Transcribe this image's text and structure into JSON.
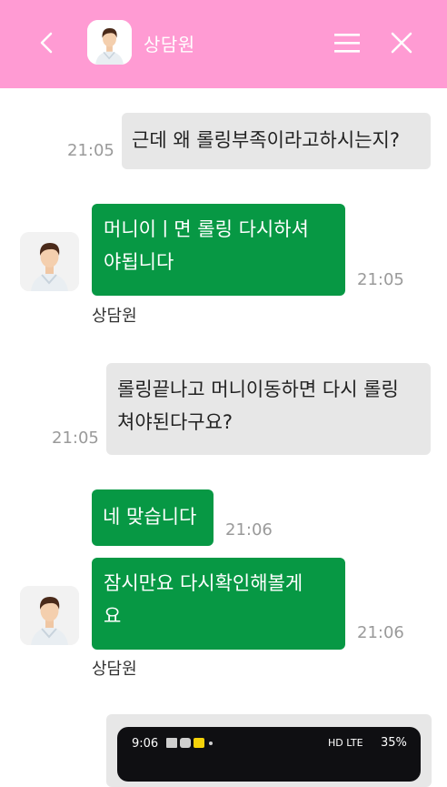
{
  "header": {
    "title": "상담원",
    "back_icon": "chevron-left-icon",
    "menu_icon": "hamburger-menu-icon",
    "close_icon": "close-icon",
    "bg_color": "#ff9bd3"
  },
  "colors": {
    "incoming_bubble": "#079844",
    "outgoing_bubble": "#e7e7e7"
  },
  "messages": [
    {
      "sender": "me",
      "line1": "근데 왜 롤링부족이라고하시는지?",
      "time": "21:05"
    },
    {
      "sender": "agent",
      "line1": "머니이ㅣ면 롤링 다시하셔",
      "line2": "야됩니다",
      "time": "21:05",
      "name": "상담원"
    },
    {
      "sender": "me",
      "line1": "롤링끝나고 머니이동하면 다시 롤링",
      "line2": "쳐야된다구요?",
      "time": "21:05"
    },
    {
      "sender": "agent",
      "line1": "네 맞습니다",
      "time": "21:06"
    },
    {
      "sender": "agent",
      "line1": "잠시만요 다시확인해볼게",
      "line2": "요",
      "time": "21:06",
      "name": "상담원"
    }
  ],
  "attachment": {
    "status_time": "9:06",
    "status_right": "HD LTE",
    "battery": "35%"
  }
}
